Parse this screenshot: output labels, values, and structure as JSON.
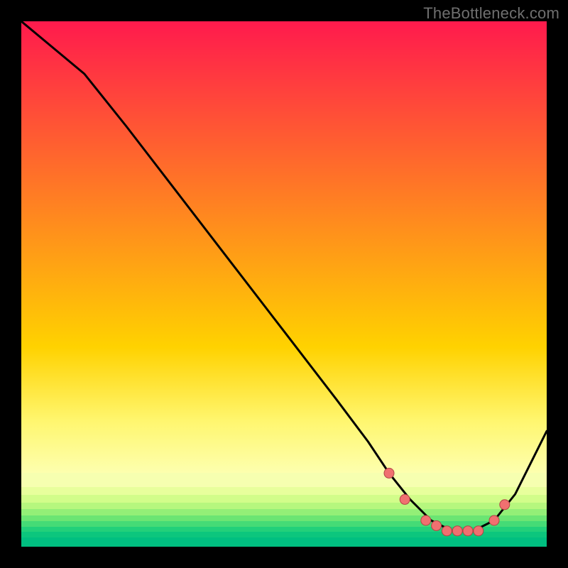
{
  "watermark": "TheBottleneck.com",
  "chart_data": {
    "type": "line",
    "title": "",
    "xlabel": "",
    "ylabel": "",
    "xlim": [
      0,
      100
    ],
    "ylim": [
      0,
      100
    ],
    "series": [
      {
        "name": "bottleneck-curve",
        "x": [
          0,
          6,
          12,
          20,
          30,
          40,
          50,
          60,
          66,
          70,
          74,
          78,
          82,
          86,
          90,
          94,
          100
        ],
        "values": [
          100,
          95,
          90,
          80,
          67,
          54,
          41,
          28,
          20,
          14,
          9,
          5,
          3,
          3,
          5,
          10,
          22
        ]
      }
    ],
    "markers": {
      "x": [
        70,
        73,
        77,
        79,
        81,
        83,
        85,
        87,
        90,
        92
      ],
      "values": [
        14,
        9,
        5,
        4,
        3,
        3,
        3,
        3,
        5,
        8
      ]
    },
    "gradient_bands": [
      {
        "height_pct": 62.0,
        "from": "#ff1a4d",
        "to": "#ffd200"
      },
      {
        "height_pct": 14.0,
        "from": "#ffd200",
        "to": "#fff66e"
      },
      {
        "height_pct": 10.0,
        "from": "#fff66e",
        "to": "#fdffae"
      },
      {
        "height_pct": 2.6,
        "color": "#f6ffb0"
      },
      {
        "height_pct": 1.6,
        "color": "#e8ff9c"
      },
      {
        "height_pct": 1.4,
        "color": "#d2fd8a"
      },
      {
        "height_pct": 1.3,
        "color": "#b6f77e"
      },
      {
        "height_pct": 1.2,
        "color": "#93ef77"
      },
      {
        "height_pct": 1.1,
        "color": "#6be573"
      },
      {
        "height_pct": 1.0,
        "color": "#45db76"
      },
      {
        "height_pct": 1.0,
        "color": "#22d07a"
      },
      {
        "height_pct": 1.0,
        "color": "#0cc67d"
      },
      {
        "height_pct": 1.8,
        "color": "#00bf80"
      }
    ],
    "curve_color": "#000000",
    "marker_fill": "#f07070",
    "marker_stroke": "#b04545",
    "marker_radius": 7
  }
}
